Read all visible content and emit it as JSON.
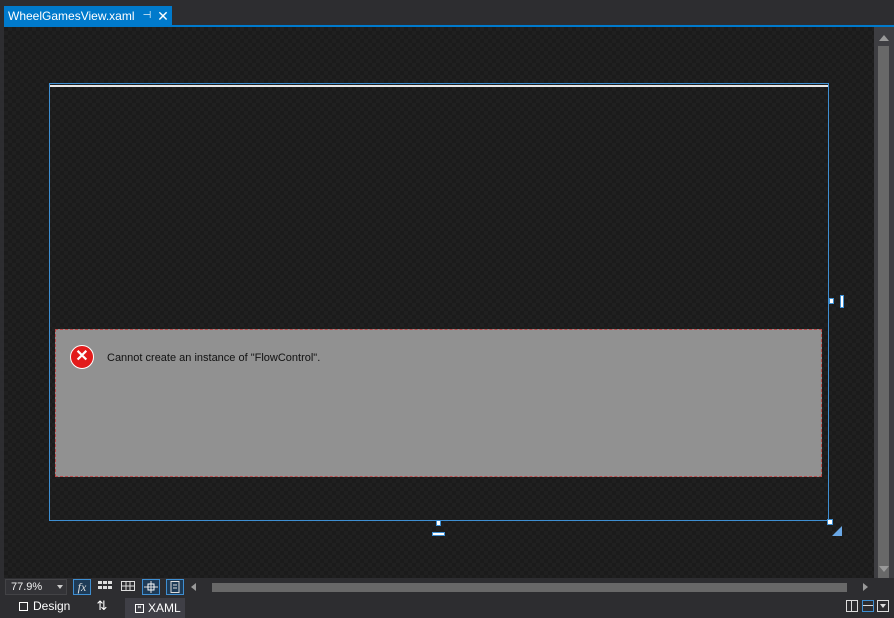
{
  "document_tab": {
    "title": "WheelGamesView.xaml",
    "pin_icon": "pin-icon",
    "close_icon": "close-icon"
  },
  "designer": {
    "error_message": "Cannot create an instance of \"FlowControl\".",
    "error_icon": "error-x-icon"
  },
  "zoom_bar": {
    "zoom_value": "77.9%",
    "buttons": [
      {
        "name": "effects-toggle-button",
        "icon": "fx-icon",
        "label": "fx",
        "active": true
      },
      {
        "name": "grid-toggle-button",
        "icon": "grid-icon",
        "active": false
      },
      {
        "name": "snap-gridlines-button",
        "icon": "snap-grid-icon",
        "active": false
      },
      {
        "name": "snap-snaplines-button",
        "icon": "snaplines-icon",
        "active": true
      },
      {
        "name": "project-code-button",
        "icon": "code-icon",
        "active": true
      }
    ]
  },
  "view_tabs": {
    "design_label": "Design",
    "xaml_label": "XAML",
    "swap_label": "⇅"
  },
  "colors": {
    "accent": "#007acc",
    "error_red": "#e21b1b",
    "error_box": "#919191"
  }
}
